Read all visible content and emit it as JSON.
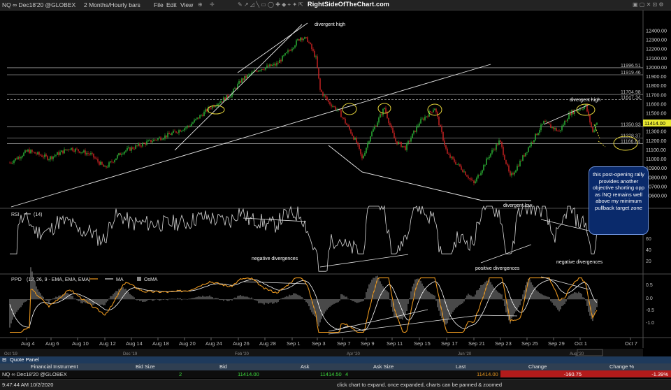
{
  "toolbar": {
    "symbol": "NQ ∞ Dec18'20 @GLOBEX",
    "period": "2 Months/Hourly bars",
    "menus": [
      "File",
      "Edit",
      "View"
    ],
    "brand": "RightSideOfTheChart.com"
  },
  "price_axis": [
    "12400.00",
    "12300.00",
    "12200.00",
    "12100.00",
    "12000.00",
    "11900.00",
    "11800.00",
    "11700.00",
    "11600.00",
    "11500.00",
    "11400.00",
    "11300.00",
    "11200.00",
    "11100.00",
    "11000.00",
    "10900.00",
    "10800.00",
    "10700.00",
    "10600.00"
  ],
  "levels": [
    "11996.51",
    "11919.46",
    "11704.98",
    "11647.34",
    "11350.93",
    "11228.37",
    "11166.84"
  ],
  "last_price": "11414.00",
  "notes": {
    "divergent_high_1": "divergent high",
    "divergent_high_2": "divergent high",
    "divergent_low": "divergent low",
    "rsi_neg_1": "negative divergences",
    "rsi_pos": "positive divergences",
    "rsi_neg_2": "negative divergences"
  },
  "callout": "this post-opening rally provides another objective shorting opp as /NQ remains well above my minimum pullback target zone",
  "rsi": {
    "title": "RSI",
    "param": "(14)",
    "ticks": [
      "60",
      "40",
      "20"
    ]
  },
  "ppo": {
    "title": "PPO",
    "param": "(12, 26, 9 - EMA, EMA, EMA)",
    "ma": "MA",
    "osma": "OsMA",
    "ticks": [
      "0.5",
      "0.0",
      "-0.5",
      "-1.0"
    ]
  },
  "x_axis": [
    "Aug 4",
    "Aug 6",
    "Aug 10",
    "Aug 12",
    "Aug 14",
    "Aug 18",
    "Aug 20",
    "Aug 24",
    "Aug 26",
    "Aug 28",
    "Sep 1",
    "Sep 3",
    "Sep 7",
    "Sep 9",
    "Sep 11",
    "Sep 15",
    "Sep 17",
    "Sep 21",
    "Sep 23",
    "Sep 25",
    "Sep 29",
    "Oct 1",
    "Oct 7"
  ],
  "mini_axis": [
    "Oct '19",
    "Dec '19",
    "Feb '20",
    "Apr '20",
    "Jun '20",
    "Aug '20"
  ],
  "quote_panel": {
    "title": "Quote Panel",
    "headers": [
      "Financial Instrument",
      "Bid Size",
      "Bid",
      "Ask",
      "Ask Size",
      "Last",
      "Change",
      "Change %"
    ],
    "row": {
      "instrument": "NQ ∞ Dec18'20 @GLOBEX",
      "bid_size": "2",
      "bid": "11414.00",
      "ask": "11414.50",
      "ask_size": "4",
      "last": "11414.00",
      "change": "-160.75",
      "change_pct": "-1.39%"
    }
  },
  "status": {
    "time": "9:47:44 AM 10/2/2020",
    "hint": "click chart to expand. once expanded, charts can be panned & zoomed"
  },
  "colors": {
    "up": "#2fbf3a",
    "down": "#d42424",
    "ppo_line": "#e8961e",
    "callout_bg": "#0a2a6b",
    "ellipse": "#e3d23a"
  }
}
